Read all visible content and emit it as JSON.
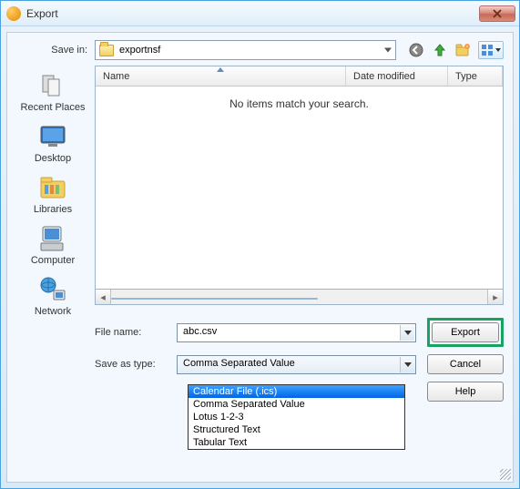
{
  "window": {
    "title": "Export"
  },
  "save_in": {
    "label": "Save in:",
    "value": "exportnsf"
  },
  "places": [
    {
      "name": "recent-places",
      "label": "Recent Places"
    },
    {
      "name": "desktop",
      "label": "Desktop"
    },
    {
      "name": "libraries",
      "label": "Libraries"
    },
    {
      "name": "computer",
      "label": "Computer"
    },
    {
      "name": "network",
      "label": "Network"
    }
  ],
  "columns": {
    "name": "Name",
    "date": "Date modified",
    "type": "Type"
  },
  "empty_message": "No items match your search.",
  "file_name": {
    "label": "File name:",
    "value": "abc.csv"
  },
  "save_as_type": {
    "label": "Save as type:",
    "value": "Comma Separated Value",
    "options": [
      "Calendar File (.ics)",
      "Comma Separated Value",
      "Lotus 1-2-3",
      "Structured Text",
      "Tabular Text"
    ],
    "selected_option_index": 0
  },
  "buttons": {
    "export": "Export",
    "cancel": "Cancel",
    "help": "Help"
  },
  "highlight": "export-button"
}
